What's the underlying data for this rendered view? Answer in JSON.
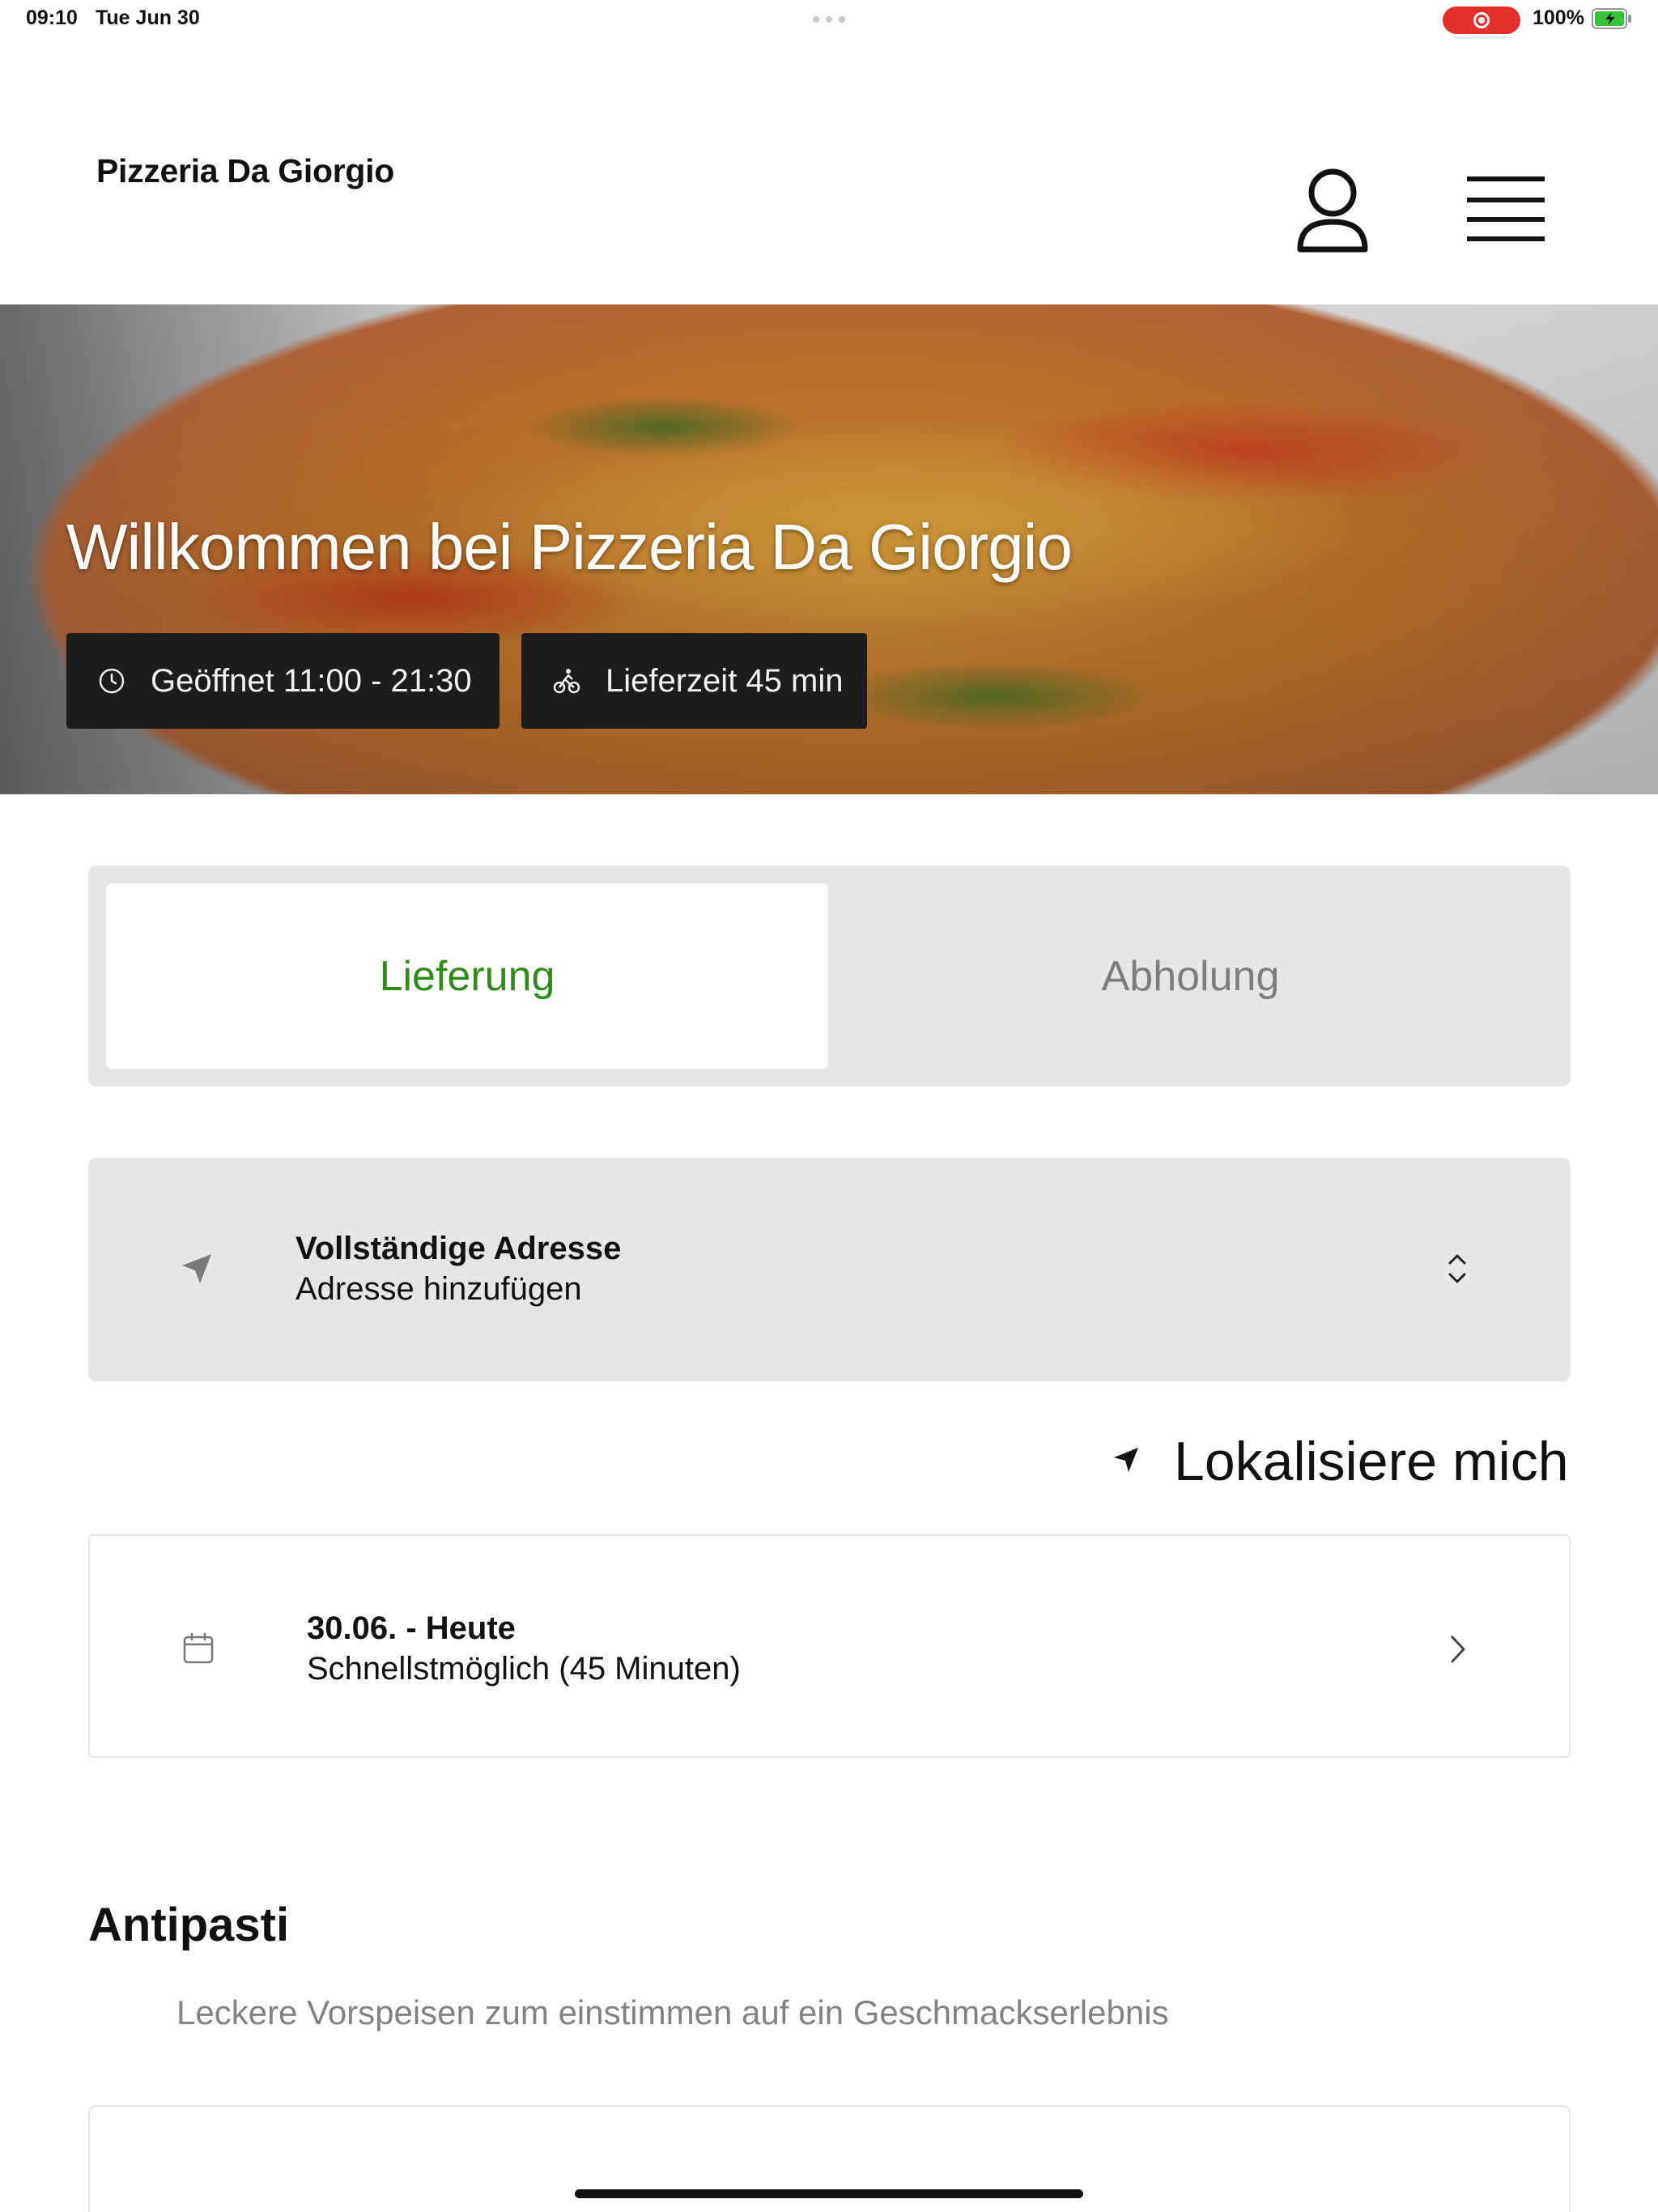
{
  "status_bar": {
    "time": "09:10",
    "date": "Tue Jun 30",
    "battery": "100%",
    "record_color": "#e3302b",
    "battery_color": "#36c23a"
  },
  "header": {
    "brand": "Pizzeria Da Giorgio",
    "user_icon": "user-icon",
    "menu_icon": "hamburger-menu-icon"
  },
  "hero": {
    "title": "Willkommen bei Pizzeria Da Giorgio",
    "opening_hours": "Geöffnet 11:00 - 21:30",
    "delivery_time": "Lieferzeit 45 min",
    "hours_icon": "clock-icon",
    "delivery_icon": "bicycle-icon"
  },
  "order_type": {
    "options": [
      "Lieferung",
      "Abholung"
    ],
    "selected": "Lieferung",
    "active_color": "#2f8a19"
  },
  "address": {
    "title": "Vollständige Adresse",
    "subtitle": "Adresse hinzufügen",
    "icon": "location-arrow-icon",
    "chevron_icon": "chevron-up-down-icon"
  },
  "locate": {
    "label": "Lokalisiere mich",
    "icon": "location-arrow-icon"
  },
  "delivery_date": {
    "title": "30.06. - Heute",
    "subtitle": "Schnellstmöglich (45 Minuten)",
    "icon": "calendar-icon",
    "chevron_icon": "chevron-right-icon"
  },
  "section": {
    "title": "Antipasti",
    "description": "Leckere Vorspeisen zum einstimmen auf ein Geschmackserlebnis"
  }
}
